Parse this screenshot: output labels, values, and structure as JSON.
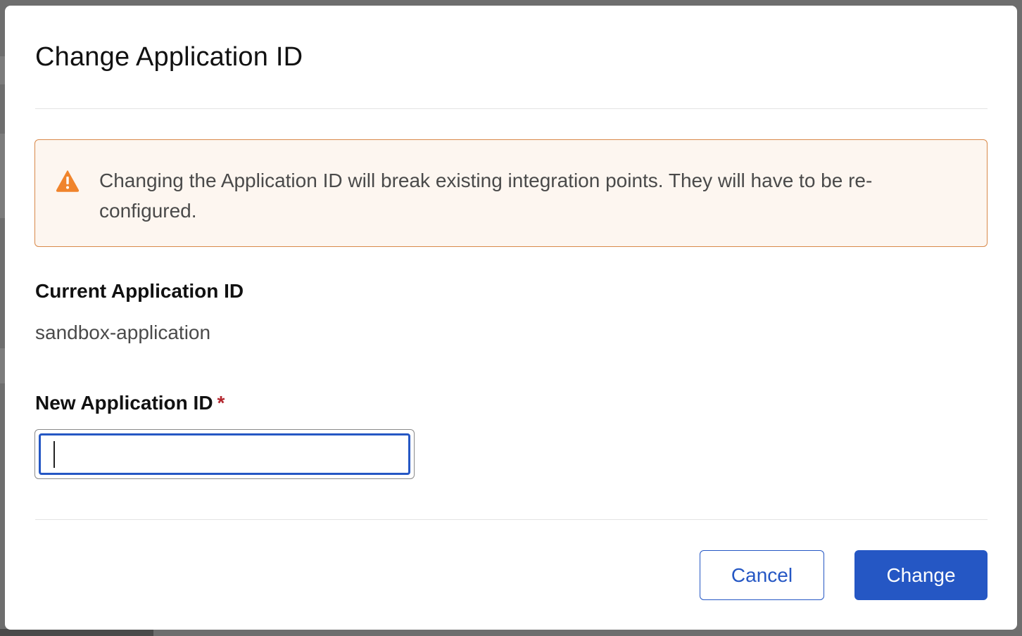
{
  "modal": {
    "title": "Change Application ID"
  },
  "alert": {
    "icon": "warning-triangle-icon",
    "message": "Changing the Application ID will break existing integration points. They will have to be re-configured.",
    "color": "#f0842c",
    "background": "#fdf6f0",
    "border": "#d9894a"
  },
  "current_id": {
    "label": "Current Application ID",
    "value": "sandbox-application"
  },
  "new_id": {
    "label": "New Application ID",
    "required_mark": "*",
    "value": "",
    "placeholder": ""
  },
  "actions": {
    "cancel_label": "Cancel",
    "change_label": "Change"
  },
  "colors": {
    "primary": "#2557c4",
    "required": "#b3262e"
  }
}
